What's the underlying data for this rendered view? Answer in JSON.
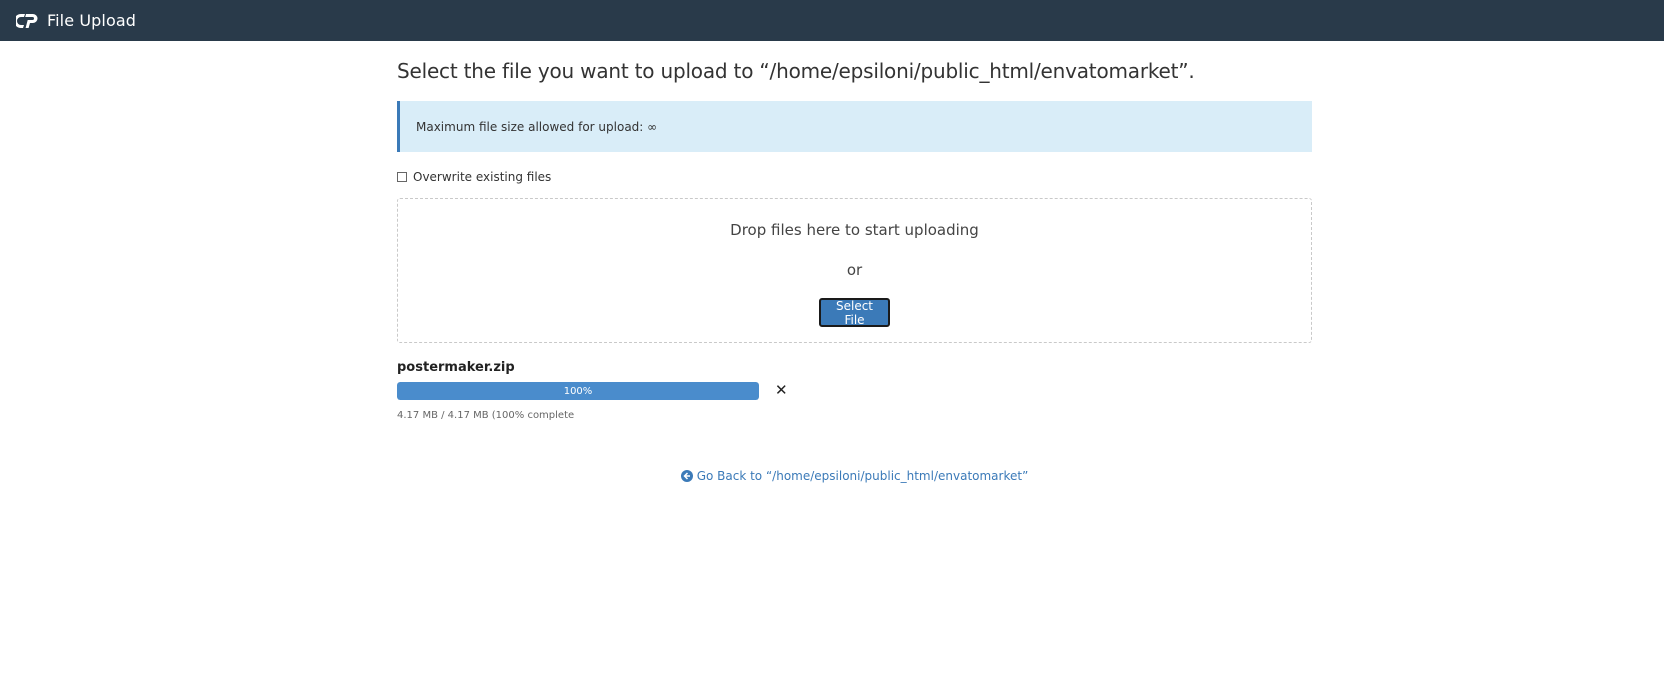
{
  "header": {
    "title": "File Upload",
    "logo_icon": "cpanel-logo-icon",
    "background": "#293a4a"
  },
  "main": {
    "heading": "Select the file you want to upload to “/home/epsiloni/public_html/envatomarket”.",
    "alert": "Maximum file size allowed for upload: ∞",
    "overwrite_label": "Overwrite existing files",
    "overwrite_checked": false,
    "dropzone": {
      "drop_text": "Drop files here to start uploading",
      "or_text": "or",
      "select_button": "Select File"
    },
    "upload": {
      "file_name": "postermaker.zip",
      "progress_percent": 100,
      "progress_label": "100%",
      "status": "4.17 MB / 4.17 MB (100% complete",
      "cancel_icon": "close-icon"
    },
    "go_back": "Go Back to “/home/epsiloni/public_html/envatomarket”",
    "go_back_icon": "arrow-circle-left-icon"
  },
  "colors": {
    "accent": "#3b7ab8",
    "alert_bg": "#d9edf8",
    "progress": "#4a8ccc"
  }
}
